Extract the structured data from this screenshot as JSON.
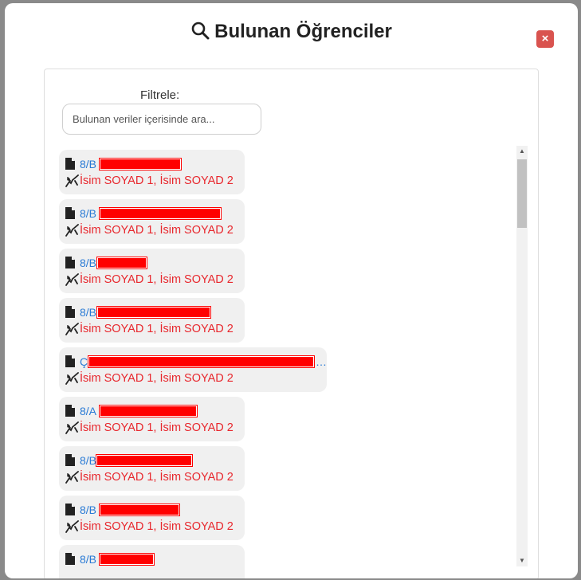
{
  "modal": {
    "title": "Bulunan Öğrenciler",
    "close_label": "×"
  },
  "filter": {
    "label": "Filtrele:",
    "placeholder": "Bulunan veriler içerisinde ara..."
  },
  "results": [
    {
      "class": "8/B",
      "teachers": "İsim SOYAD 1, İsim SOYAD 2"
    },
    {
      "class": "8/B",
      "teachers": "İsim SOYAD 1, İsim SOYAD 2"
    },
    {
      "class": "8/B",
      "teachers": "İsim SOYAD 1, İsim SOYAD 2"
    },
    {
      "class": "8/B",
      "teachers": "İsim SOYAD 1, İsim SOYAD 2"
    },
    {
      "class": "Ç",
      "teachers": "İsim SOYAD 1, İsim SOYAD 2"
    },
    {
      "class": "8/A",
      "teachers": "İsim SOYAD 1, İsim SOYAD 2"
    },
    {
      "class": "8/B",
      "teachers": "İsim SOYAD 1, İsim SOYAD 2"
    },
    {
      "class": "8/B",
      "teachers": "İsim SOYAD 1, İsim SOYAD 2"
    },
    {
      "class": "8/B",
      "teachers": ""
    }
  ],
  "colors": {
    "class_text": "#2a7bd5",
    "teacher_text": "#e8272d",
    "close_button": "#d9534f",
    "redaction": "#ff0000"
  },
  "icons": {
    "title": "search-icon",
    "close": "close-icon",
    "file": "file-icon",
    "teacher": "chalkboard-teacher-icon"
  }
}
